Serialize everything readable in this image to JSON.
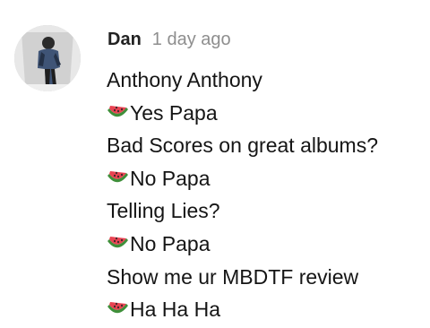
{
  "comment": {
    "author": "Dan",
    "timestamp": "1 day ago",
    "avatar_icon": "user-avatar-photo",
    "emoji_icon": "watermelon-icon",
    "lines": [
      {
        "text": "Anthony Anthony",
        "emoji": false
      },
      {
        "text": "Yes Papa",
        "emoji": true
      },
      {
        "text": "Bad Scores on great albums?",
        "emoji": false
      },
      {
        "text": "No Papa",
        "emoji": true
      },
      {
        "text": "Telling Lies?",
        "emoji": false
      },
      {
        "text": "No Papa",
        "emoji": true
      },
      {
        "text": "Show me ur MBDTF review",
        "emoji": false
      },
      {
        "text": "Ha Ha Ha",
        "emoji": true
      }
    ]
  },
  "colors": {
    "author": "#222222",
    "timestamp": "#8e8e8e",
    "body_text": "#151515",
    "watermelon_rind": "#3f8f3a",
    "watermelon_flesh": "#e84352"
  }
}
